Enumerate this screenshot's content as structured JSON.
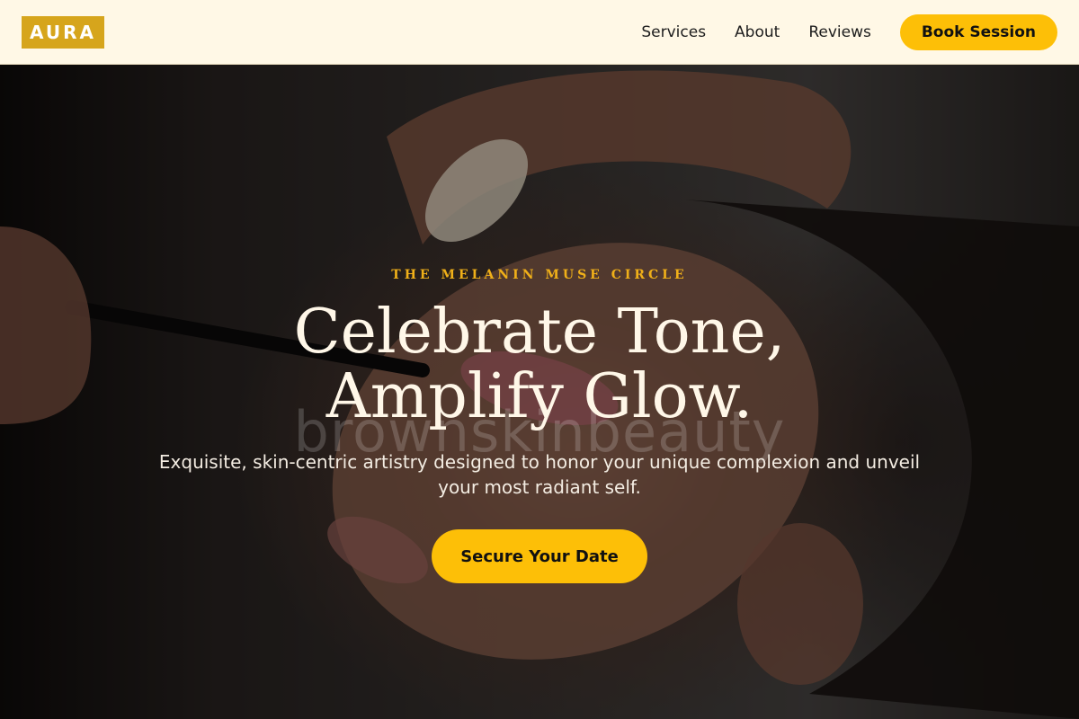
{
  "header": {
    "logo": "AURA",
    "nav": [
      {
        "label": "Services"
      },
      {
        "label": "About"
      },
      {
        "label": "Reviews"
      }
    ],
    "book_label": "Book Session"
  },
  "hero": {
    "eyebrow": "THE MELANIN MUSE CIRCLE",
    "headline_line1": "Celebrate Tone,",
    "headline_line2": "Amplify Glow.",
    "subtext": "Exquisite, skin-centric artistry designed to honor your unique complexion and unveil your most radiant self.",
    "cta_label": "Secure Your Date",
    "watermark": "brownskinbeauty"
  },
  "colors": {
    "accent": "#fdbf07",
    "logo_bg": "#d6a51c",
    "header_bg": "#fff8e6",
    "eyebrow": "#f0b019"
  }
}
